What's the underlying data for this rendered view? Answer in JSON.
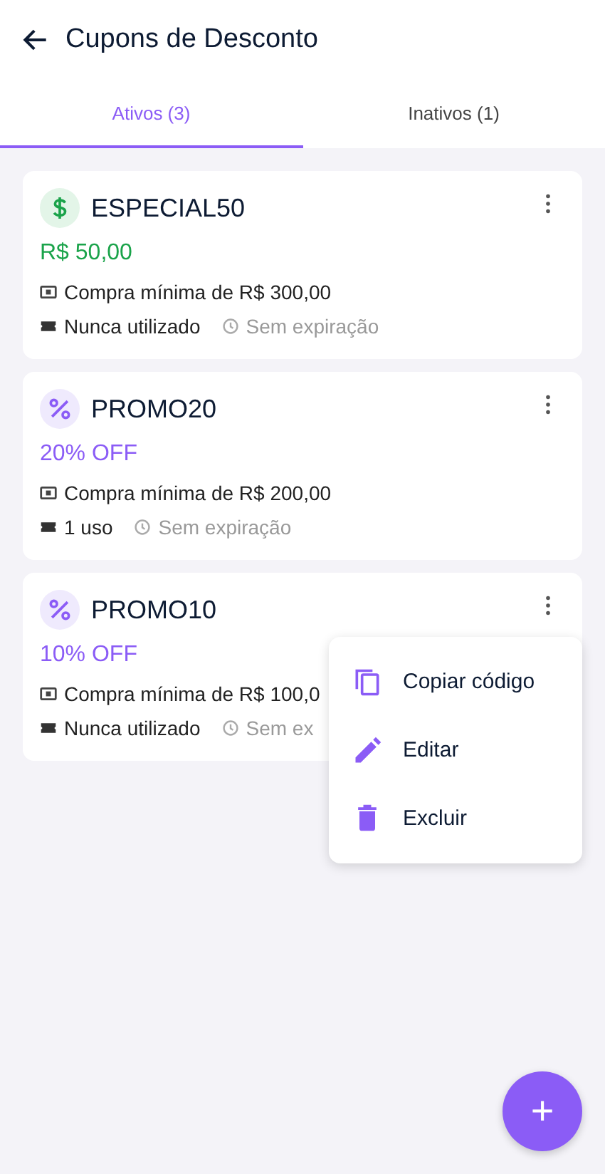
{
  "header": {
    "title": "Cupons de Desconto"
  },
  "tabs": [
    {
      "label": "Ativos (3)",
      "selected": true
    },
    {
      "label": "Inativos (1)",
      "selected": false
    }
  ],
  "coupons": [
    {
      "kind": "fixed",
      "code": "ESPECIAL50",
      "value": "R$ 50,00",
      "minimum": "Compra mínima de R$ 300,00",
      "usage": "Nunca utilizado",
      "expiry": "Sem expiração"
    },
    {
      "kind": "percent",
      "code": "PROMO20",
      "value": "20% OFF",
      "minimum": "Compra mínima de R$ 200,00",
      "usage": "1 uso",
      "expiry": "Sem expiração"
    },
    {
      "kind": "percent",
      "code": "PROMO10",
      "value": "10% OFF",
      "minimum": "Compra mínima de R$ 100,0",
      "usage": "Nunca utilizado",
      "expiry": "Sem ex"
    }
  ],
  "menu": {
    "items": [
      {
        "kind": "copy",
        "label": "Copiar código"
      },
      {
        "kind": "edit",
        "label": "Editar"
      },
      {
        "kind": "delete",
        "label": "Excluir"
      }
    ]
  },
  "fab": {
    "label": "+"
  }
}
